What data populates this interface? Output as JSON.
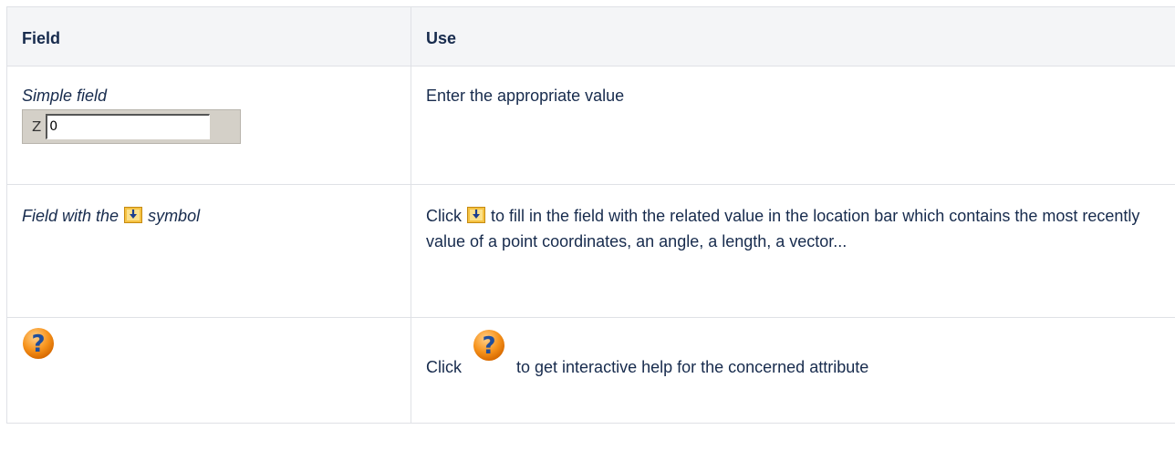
{
  "table": {
    "headers": {
      "field": "Field",
      "use": "Use"
    },
    "rows": [
      {
        "field_label": "Simple field",
        "widget": {
          "label": "Z",
          "value": "0"
        },
        "use": "Enter the appropriate value"
      },
      {
        "field_prefix": "Field with the",
        "field_suffix": "symbol",
        "icon": "location-bar-icon",
        "use_prefix": "Click",
        "use_suffix": "to fill in the field with the related value in the location bar which contains the most recently value of a point coordinates, an angle, a length, a vector..."
      },
      {
        "icon": "help-icon",
        "use_prefix": "Click",
        "use_suffix": "to get interactive help for the concerned attribute"
      }
    ]
  },
  "colors": {
    "header_bg": "#f4f5f7",
    "border": "#dfe1e6",
    "help_icon": "#f7941d",
    "location_icon": "#f5c242"
  }
}
